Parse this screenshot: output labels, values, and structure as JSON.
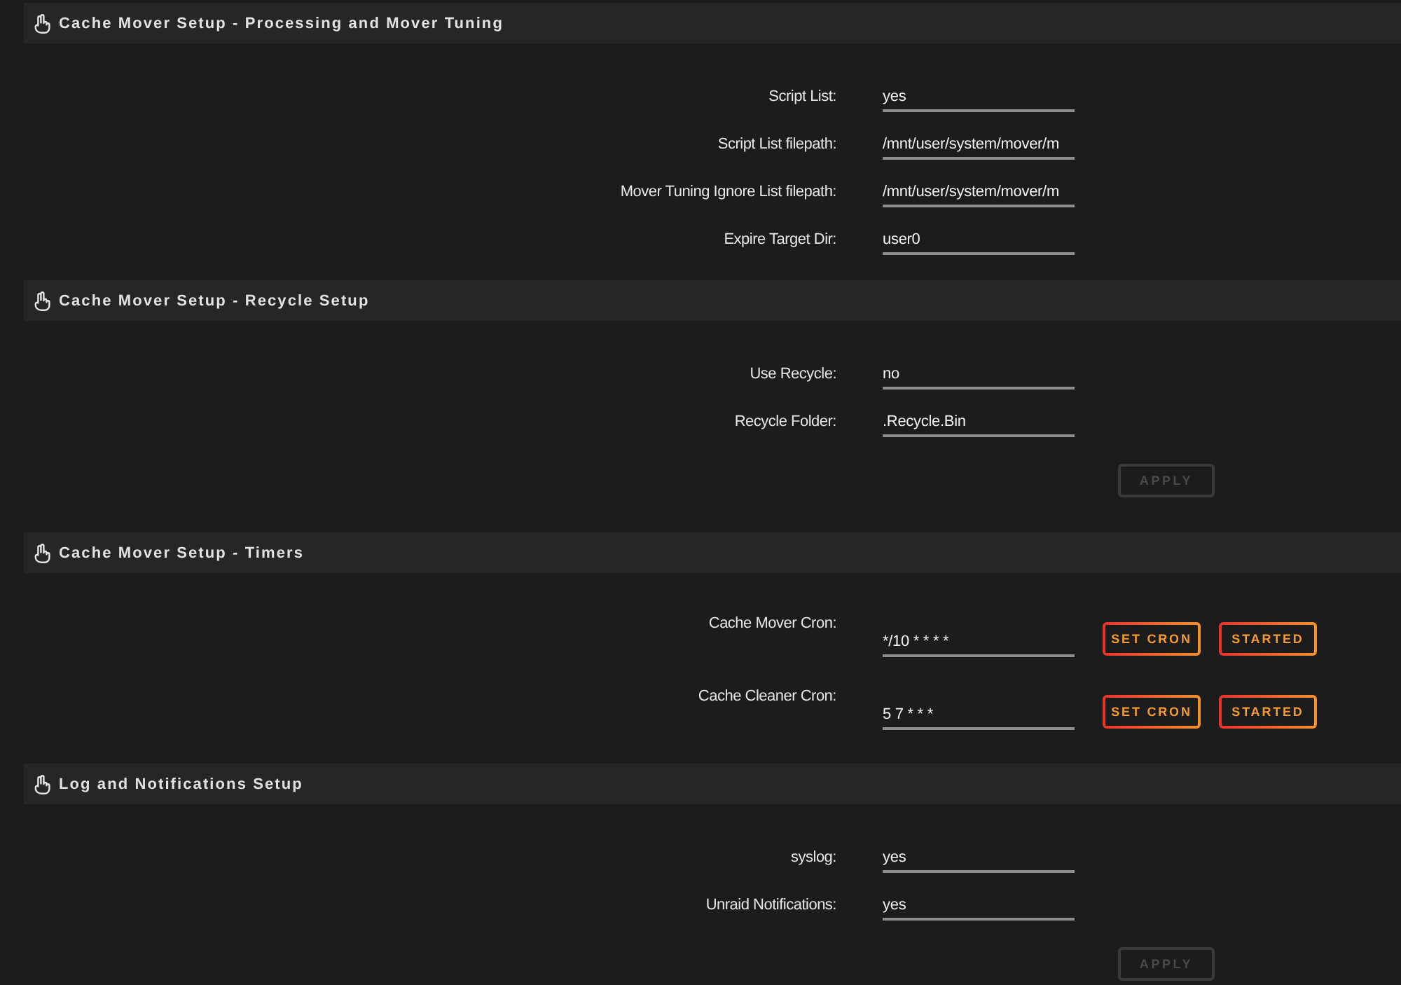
{
  "sections": [
    {
      "title": "Cache Mover Setup - Processing and Mover Tuning",
      "rows": [
        {
          "label": "Script List:",
          "value": "yes"
        },
        {
          "label": "Script List filepath:",
          "value": "/mnt/user/system/mover/m"
        },
        {
          "label": "Mover Tuning Ignore List filepath:",
          "value": "/mnt/user/system/mover/m"
        },
        {
          "label": "Expire Target Dir:",
          "value": "user0"
        }
      ]
    },
    {
      "title": "Cache Mover Setup - Recycle Setup",
      "rows": [
        {
          "label": "Use Recycle:",
          "value": "no"
        },
        {
          "label": "Recycle Folder:",
          "value": ".Recycle.Bin"
        }
      ],
      "apply": {
        "label": "APPLY",
        "disabled": true
      }
    },
    {
      "title": "Cache Mover Setup - Timers",
      "rows": [
        {
          "label": "Cache Mover Cron:",
          "value": "*/10 * * * *",
          "buttons": [
            "SET CRON",
            "STARTED"
          ]
        },
        {
          "label": "Cache Cleaner Cron:",
          "value": "5 7 * * *",
          "buttons": [
            "SET CRON",
            "STARTED"
          ]
        }
      ]
    },
    {
      "title": "Log and Notifications Setup",
      "rows": [
        {
          "label": "syslog:",
          "value": "yes"
        },
        {
          "label": "Unraid Notifications:",
          "value": "yes"
        }
      ],
      "apply": {
        "label": "APPLY",
        "disabled": true
      }
    }
  ]
}
